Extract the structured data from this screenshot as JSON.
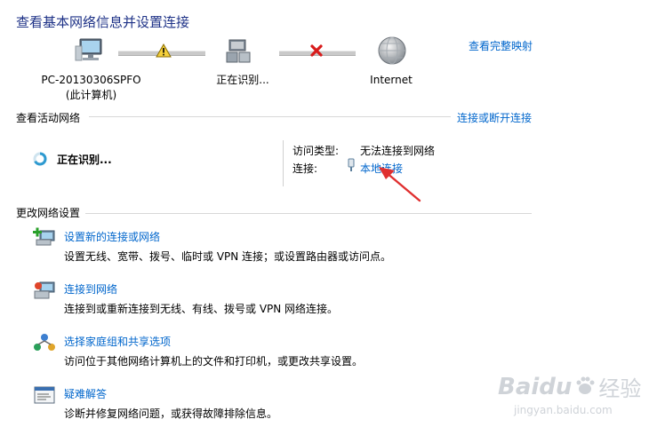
{
  "page": {
    "title": "查看基本网络信息并设置连接",
    "view_full_map_link": "查看完整映射"
  },
  "network_map": {
    "computer_name": "PC-20130306SPFO",
    "computer_sub": "(此计算机)",
    "network_label": "正在识别...",
    "internet_label": "Internet"
  },
  "active_networks": {
    "section_title": "查看活动网络",
    "connect_disconnect_link": "连接或断开连接",
    "identifying_text": "正在识别...",
    "access_type_label": "访问类型:",
    "access_type_value": "无法连接到网络",
    "connections_label": "连接:",
    "connection_link": "本地连接"
  },
  "change_settings": {
    "section_title": "更改网络设置",
    "tasks": [
      {
        "title": "设置新的连接或网络",
        "desc": "设置无线、宽带、拨号、临时或 VPN 连接；或设置路由器或访问点。",
        "icon": "new-connection-icon"
      },
      {
        "title": "连接到网络",
        "desc": "连接到或重新连接到无线、有线、拨号或 VPN 网络连接。",
        "icon": "connect-network-icon"
      },
      {
        "title": "选择家庭组和共享选项",
        "desc": "访问位于其他网络计算机上的文件和打印机，或更改共享设置。",
        "icon": "homegroup-icon"
      },
      {
        "title": "疑难解答",
        "desc": "诊断并修复网络问题，或获得故障排除信息。",
        "icon": "troubleshoot-icon"
      }
    ]
  },
  "watermark": {
    "brand": "Baidu",
    "brand_cn": "经验",
    "url": "jingyan.baidu.com"
  },
  "colors": {
    "title": "#1e3287",
    "link": "#0066cc",
    "arrow": "#e03030"
  }
}
